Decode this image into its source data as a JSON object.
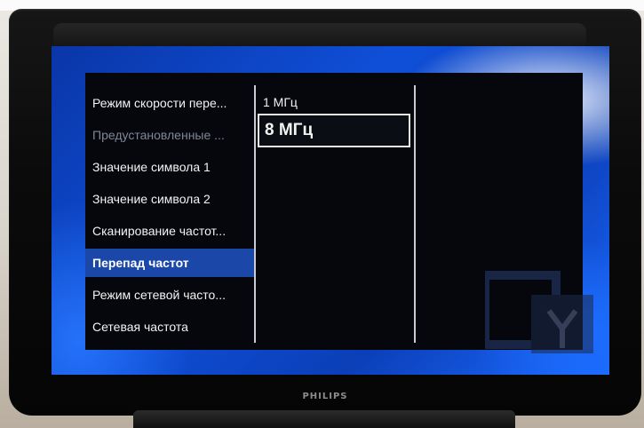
{
  "tv": {
    "brand": "PHILIPS"
  },
  "menu": {
    "items": [
      {
        "label": "Режим скорости пере...",
        "state": "normal"
      },
      {
        "label": "Предустановленные ...",
        "state": "dimmed"
      },
      {
        "label": "Значение символа 1",
        "state": "normal"
      },
      {
        "label": "Значение символа 2",
        "state": "normal"
      },
      {
        "label": "Сканирование частот...",
        "state": "normal"
      },
      {
        "label": "Перепад частот",
        "state": "selected"
      },
      {
        "label": "Режим сетевой часто...",
        "state": "normal"
      },
      {
        "label": "Сетевая частота",
        "state": "normal"
      }
    ]
  },
  "options": {
    "items": [
      {
        "label": "1 МГц",
        "state": "normal"
      },
      {
        "label": "8 МГц",
        "state": "focused"
      }
    ]
  },
  "colors": {
    "selection_highlight": "#1b47a9",
    "screen_background": "#0f4fd8",
    "osd_background": "#05070d"
  }
}
